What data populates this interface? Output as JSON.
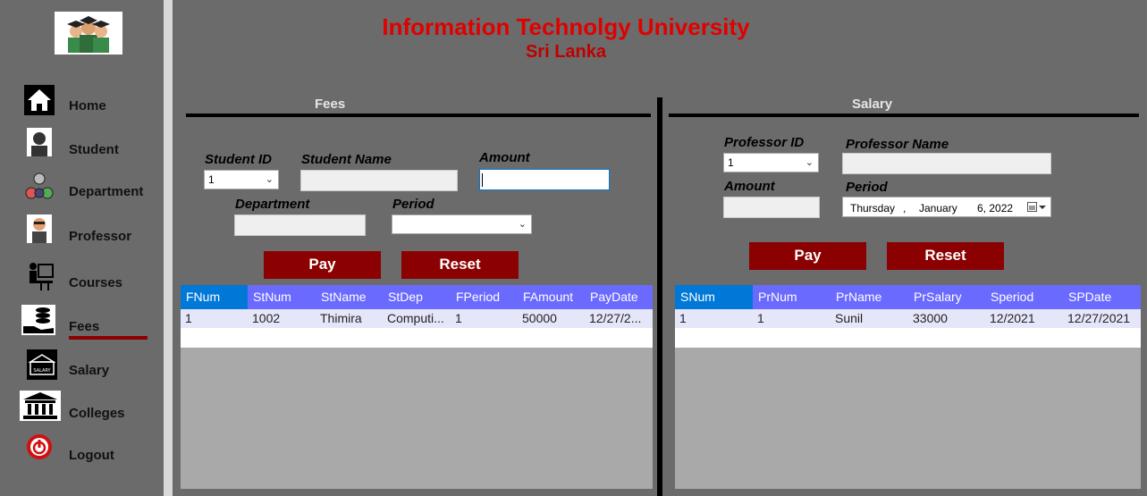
{
  "header": {
    "title": "Information Technolgy University",
    "subtitle": "Sri Lanka"
  },
  "sidebar": {
    "items": [
      {
        "label": "Home",
        "icon": "home-icon"
      },
      {
        "label": "Student",
        "icon": "student-icon"
      },
      {
        "label": "Department",
        "icon": "department-icon"
      },
      {
        "label": "Professor",
        "icon": "professor-icon"
      },
      {
        "label": "Courses",
        "icon": "courses-icon"
      },
      {
        "label": "Fees",
        "icon": "fees-icon"
      },
      {
        "label": "Salary",
        "icon": "salary-icon"
      },
      {
        "label": "Colleges",
        "icon": "colleges-icon"
      },
      {
        "label": "Logout",
        "icon": "logout-icon"
      }
    ],
    "active": "Fees"
  },
  "fees": {
    "title": "Fees",
    "student_id_label": "Student ID",
    "student_id_value": "1",
    "student_name_label": "Student Name",
    "student_name_value": "",
    "amount_label": "Amount",
    "amount_value": "",
    "department_label": "Department",
    "department_value": "",
    "period_label": "Period",
    "period_value": "",
    "pay_label": "Pay",
    "reset_label": "Reset",
    "table": {
      "columns": [
        "FNum",
        "StNum",
        "StName",
        "StDep",
        "FPeriod",
        "FAmount",
        "PayDate"
      ],
      "rows": [
        [
          "1",
          "1002",
          "Thimira",
          "Computi...",
          "1",
          "50000",
          "12/27/2..."
        ]
      ]
    }
  },
  "salary": {
    "title": "Salary",
    "professor_id_label": "Professor ID",
    "professor_id_value": "1",
    "professor_name_label": "Professor Name",
    "professor_name_value": "",
    "amount_label": "Amount",
    "amount_value": "",
    "period_label": "Period",
    "period_day": "Thursday",
    "period_month": "January",
    "period_date": "6, 2022",
    "pay_label": "Pay",
    "reset_label": "Reset",
    "table": {
      "columns": [
        "SNum",
        "PrNum",
        "PrName",
        "PrSalary",
        "Speriod",
        "SPDate"
      ],
      "rows": [
        [
          "1",
          "1",
          "Sunil",
          "33000",
          "12/2021",
          "12/27/2021"
        ]
      ]
    }
  },
  "colors": {
    "accent_red": "#8b0000",
    "title_red": "#e10000",
    "grid_header": "#6a6aff",
    "selected_header": "#0078d7"
  }
}
